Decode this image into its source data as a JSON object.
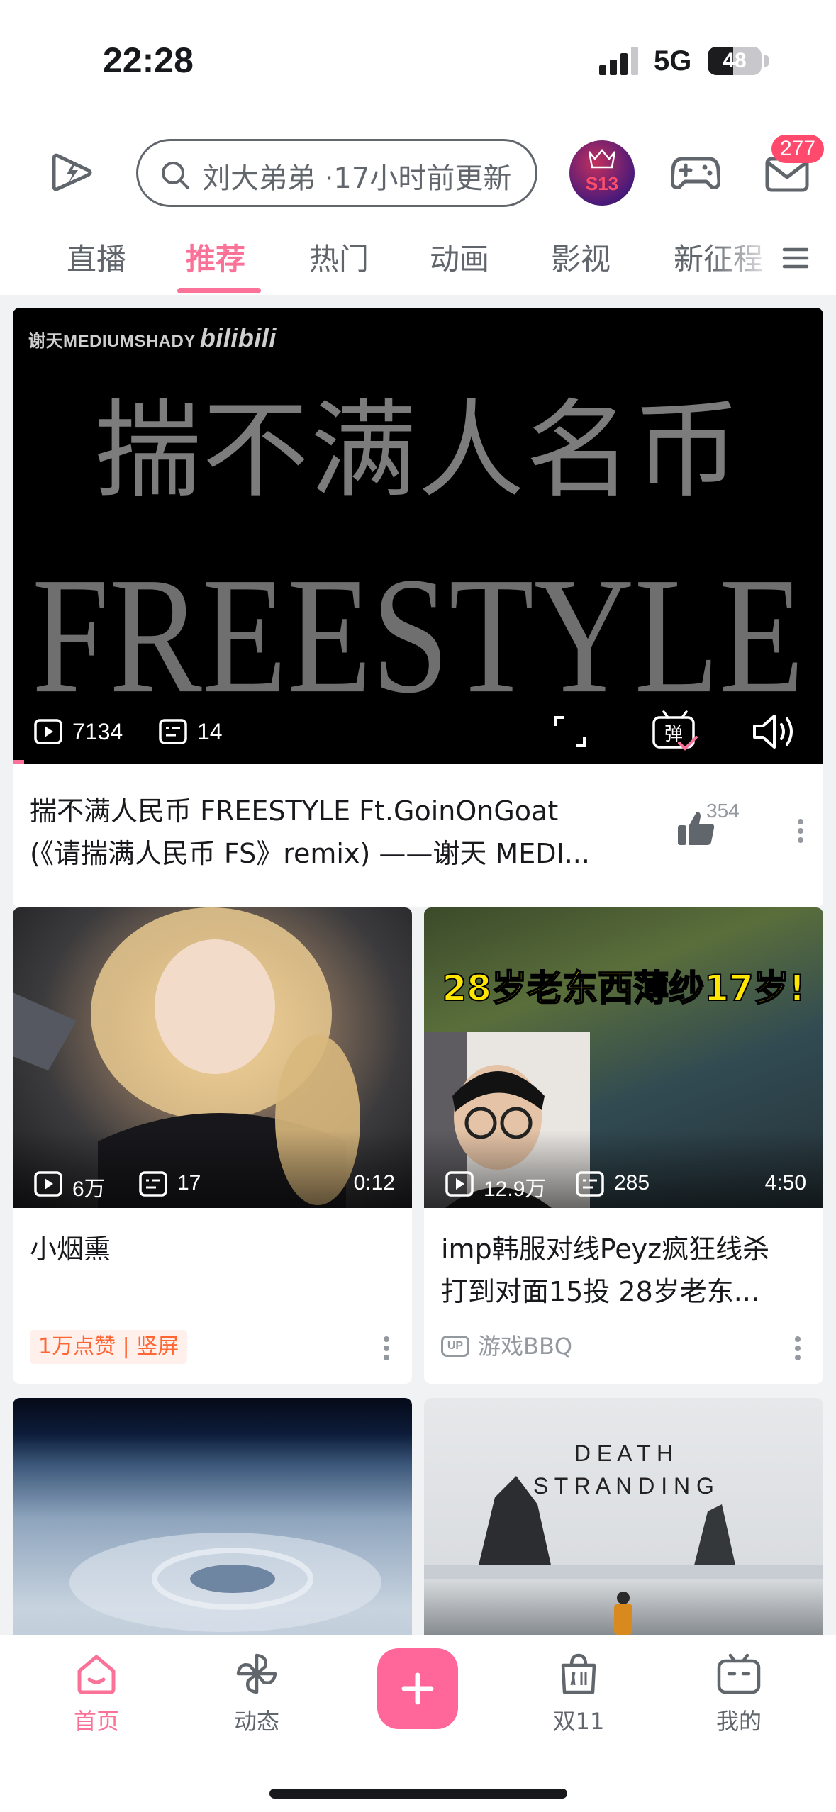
{
  "status_bar": {
    "time": "22:28",
    "network": "5G",
    "battery": "48",
    "battery_level": 0.48
  },
  "header": {
    "search_placeholder": "刘大弟弟 ·17小时前更新",
    "event_badge": "S13",
    "mail_count": "277",
    "icons": [
      "bilibili-logo-icon",
      "search-icon",
      "s13-event-icon",
      "gamepad-icon",
      "mail-icon"
    ]
  },
  "tabs": [
    {
      "label": "直播"
    },
    {
      "label": "推荐",
      "active": true
    },
    {
      "label": "热门"
    },
    {
      "label": "动画"
    },
    {
      "label": "影视"
    },
    {
      "label": "新征程"
    }
  ],
  "featured": {
    "watermark": "谢天MEDIUMSHADY",
    "watermark_logo": "bilibili",
    "overlay_title_cn": "揣不满人名币",
    "overlay_title_en": "FREESTYLE",
    "plays": "7134",
    "danmaku": "14",
    "danmaku_toggle": "弹",
    "title_line1": "揣不满人民币 FREESTYLE Ft.GoinOnGoat",
    "title_line2": "(《请揣满人民币 FS》remix) ——谢天 MEDI...",
    "likes": "354"
  },
  "cards": [
    {
      "plays": "6万",
      "danmaku": "17",
      "duration": "0:12",
      "title_line1": "小烟熏",
      "title_line2": "",
      "tag": "1万点赞 | 竖屏"
    },
    {
      "overlay_caption": "28岁老东西薄纱17岁!",
      "plays": "12.9万",
      "danmaku": "285",
      "duration": "4:50",
      "title_line1": "imp韩服对线Peyz疯狂线杀",
      "title_line2": "打到对面15投 28岁老东...",
      "up_badge": "UP",
      "up_name": "游戏BBQ"
    },
    {},
    {
      "overlay_word1": "D E A T H",
      "overlay_word2": "S T R A N D I N G"
    }
  ],
  "bottom_nav": [
    {
      "label": "首页",
      "active": true
    },
    {
      "label": "动态"
    },
    {
      "label": ""
    },
    {
      "label": "双11"
    },
    {
      "label": "我的"
    }
  ],
  "colors": {
    "brand_pink": "#fb7299",
    "badge_red": "#ff4a6d",
    "tag_orange": "#ff6633"
  }
}
